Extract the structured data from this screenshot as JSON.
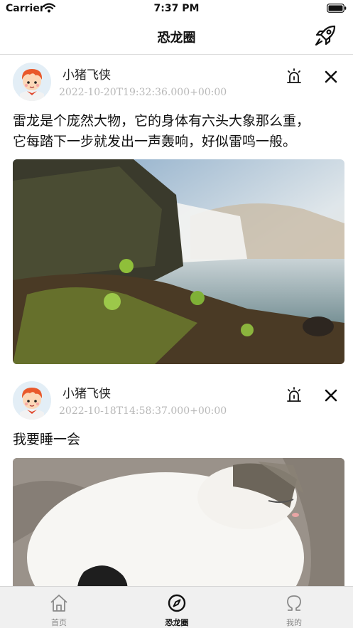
{
  "status_bar": {
    "carrier": "Carrier",
    "time": "7:37 PM"
  },
  "nav": {
    "title": "恐龙圈",
    "action_icon": "rocket-icon"
  },
  "posts": [
    {
      "username": "小猪飞侠",
      "timestamp": "2022-10-20T19:32:36.000+00:00",
      "text_lines": [
        "雷龙是个庞然大物，它的身体有六头大象那么重，",
        "它每踏下一步就发出一声轰响，好似雷鸣一般。"
      ],
      "image": "waterfall-photo"
    },
    {
      "username": "小猪飞侠",
      "timestamp": "2022-10-18T14:58:37.000+00:00",
      "text_lines": [
        "我要睡一会"
      ],
      "image": "sleeping-cat-photo"
    }
  ],
  "tabs": [
    {
      "label": "首页",
      "icon": "home-icon",
      "active": false
    },
    {
      "label": "恐龙圈",
      "icon": "compass-icon",
      "active": true
    },
    {
      "label": "我的",
      "icon": "omega-icon",
      "active": false
    }
  ],
  "colors": {
    "timestamp": "#b8b8b8",
    "tab_inactive": "#8a8a8a",
    "tab_active": "#111111",
    "divider": "#dddddd"
  }
}
